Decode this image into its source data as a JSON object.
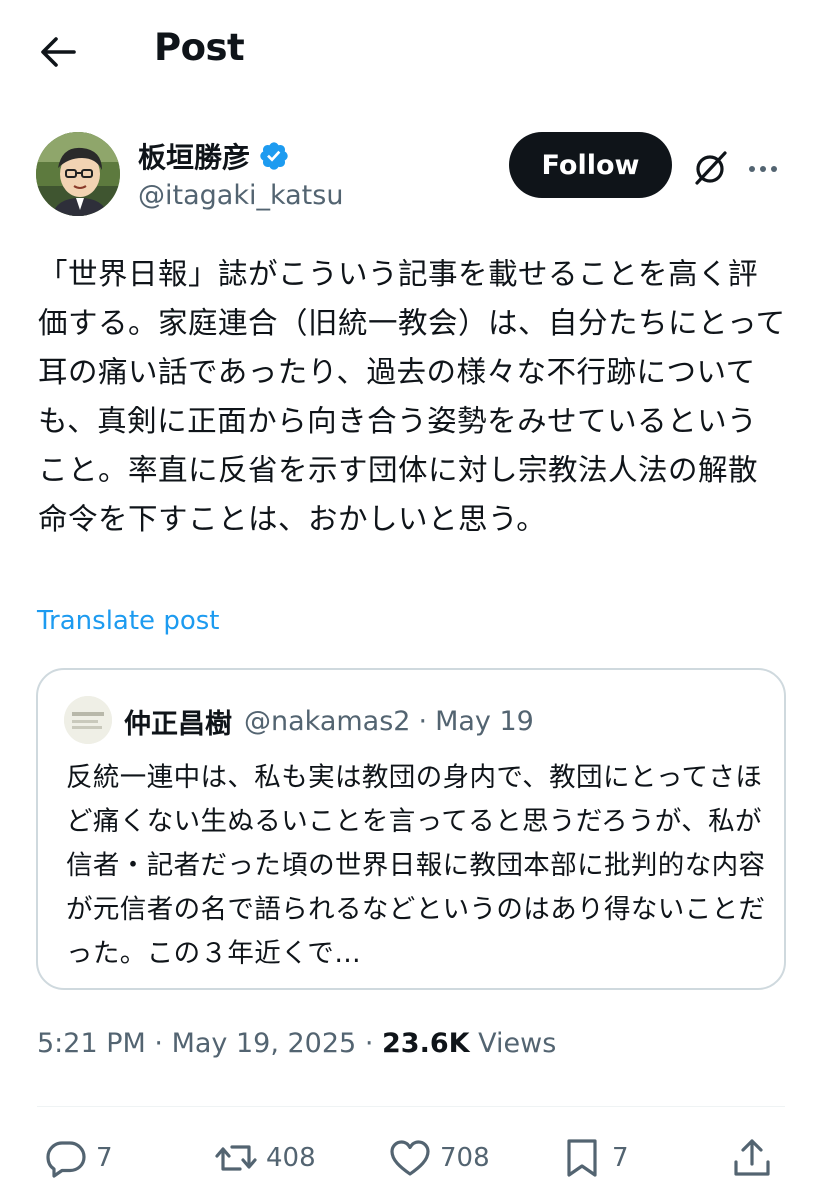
{
  "header": {
    "title": "Post"
  },
  "author": {
    "display_name": "板垣勝彦",
    "handle": "@itagaki_katsu",
    "follow_label": "Follow",
    "verified_color": "#1d9bf0"
  },
  "post": {
    "text": "「世界日報」誌がこういう記事を載せることを高く評価する。家庭連合（旧統一教会）は、自分たちにとって耳の痛い話であったり、過去の様々な不行跡についても、真剣に正面から向き合う姿勢をみせているということ。率直に反省を示す団体に対し宗教法人法の解散命令を下すことは、おかしいと思う。",
    "translate_label": "Translate post"
  },
  "quote": {
    "display_name": "仲正昌樹",
    "handle": "@nakamas2",
    "separator": "·",
    "date": "May 19",
    "text": "反統一連中は、私も実は教団の身内で、教団にとってさほど痛くない生ぬるいことを言ってると思うだろうが、私が信者・記者だった頃の世界日報に教団本部に批判的な内容が元信者の名で語られるなどというのはあり得ないことだった。この３年近くで…"
  },
  "meta": {
    "time": "5:21 PM",
    "sep1": "·",
    "date": "May 19, 2025",
    "sep2": "·",
    "views_count": "23.6K",
    "views_label": "Views"
  },
  "actions": {
    "replies": "7",
    "reposts": "408",
    "likes": "708",
    "bookmarks": "7"
  },
  "icons": {
    "back": "arrow-left-icon",
    "verified": "verified-badge-icon",
    "grok": "grok-icon",
    "more": "more-dots-icon",
    "reply": "reply-icon",
    "repost": "repost-icon",
    "like": "heart-icon",
    "bookmark": "bookmark-icon",
    "share": "share-icon"
  }
}
